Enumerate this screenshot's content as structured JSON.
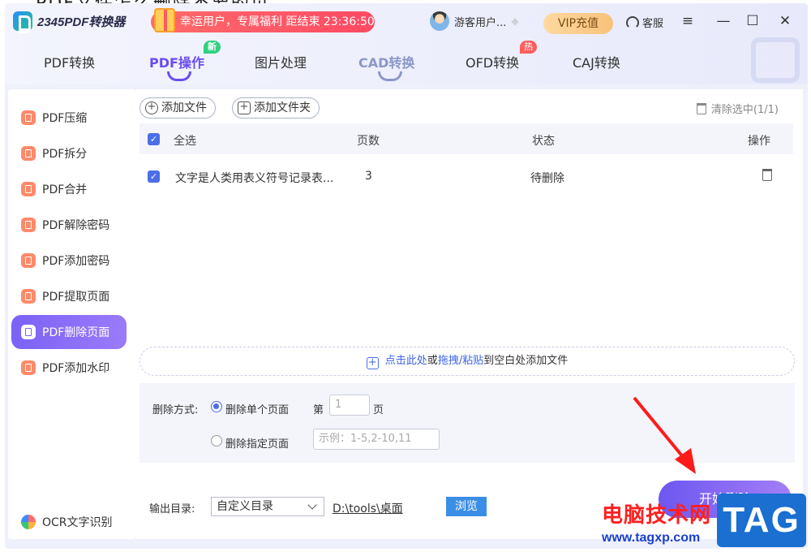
{
  "page_title_cut": "PDF文件怎么删除不要的页",
  "app": {
    "logo": "2345PDF转换器",
    "promo": "幸运用户，专属福利 距结束 23:36:50",
    "user_name": "游客用户...",
    "vip_label": "VIP充值",
    "service_label": "客服",
    "menu_icon": "≡",
    "minimize_icon": "—",
    "maximize_icon": "☐",
    "close_icon": "✕"
  },
  "tabs": [
    {
      "label": "PDF转换",
      "badge": ""
    },
    {
      "label": "PDF操作",
      "badge": "新"
    },
    {
      "label": "图片处理",
      "badge": ""
    },
    {
      "label": "CAD转换",
      "badge": ""
    },
    {
      "label": "OFD转换",
      "badge": "热"
    },
    {
      "label": "CAJ转换",
      "badge": ""
    }
  ],
  "sidebar": {
    "items": [
      {
        "label": "PDF压缩"
      },
      {
        "label": "PDF拆分"
      },
      {
        "label": "PDF合并"
      },
      {
        "label": "PDF解除密码"
      },
      {
        "label": "PDF添加密码"
      },
      {
        "label": "PDF提取页面"
      },
      {
        "label": "PDF删除页面"
      },
      {
        "label": "PDF添加水印"
      }
    ],
    "ocr_label": "OCR文字识别"
  },
  "toolbar": {
    "add_file": "添加文件",
    "add_folder": "添加文件夹",
    "clear_selected": "清除选中(1/1)"
  },
  "table": {
    "headers": {
      "select_all": "全选",
      "pages": "页数",
      "status": "状态",
      "action": "操作"
    },
    "rows": [
      {
        "name": "文字是人类用表义符号记录表...",
        "pages": "3",
        "status": "待删除"
      }
    ]
  },
  "dropzone": {
    "click_here": "点击此处",
    "or": "或",
    "drag_paste": "拖拽/粘贴",
    "rest": "到空白处添加文件"
  },
  "options": {
    "method_label": "删除方式:",
    "single_page": "删除单个页面",
    "page_prefix": "第",
    "page_value": "1",
    "page_suffix": "页",
    "specified_pages": "删除指定页面",
    "specified_placeholder": "示例：1-5,2-10,11"
  },
  "output": {
    "label": "输出目录:",
    "dir_type": "自定义目录",
    "path": "D:\\tools\\桌面",
    "browse": "浏览",
    "start": "开始删除"
  },
  "watermark": {
    "site_cn": "电脑技术网",
    "site_url": "www.tagxp.com",
    "tag": "TAG"
  },
  "colors": {
    "accent": "#6a4cf0",
    "arrow": "#ff1a1a",
    "link": "#3a63e6"
  }
}
